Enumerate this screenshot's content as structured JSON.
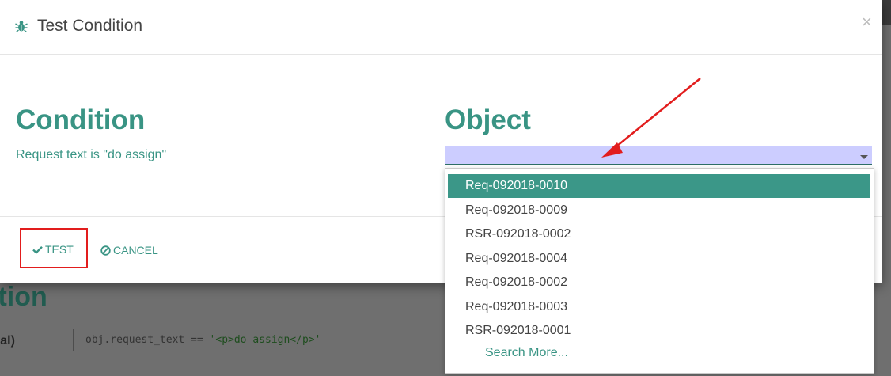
{
  "background": {
    "heading": "ition",
    "field_label": "ral)",
    "code": {
      "prefix": "obj.request_text == ",
      "value": "'<p>do assign</p>'"
    }
  },
  "modal": {
    "icon": "bug-icon",
    "title": "Test Condition",
    "close_label": "×"
  },
  "condition": {
    "heading": "Condition",
    "text": "Request text is \"do assign\""
  },
  "object": {
    "heading": "Object",
    "value": "",
    "options": [
      "Req-092018-0010",
      "Req-092018-0009",
      "RSR-092018-0002",
      "Req-092018-0004",
      "Req-092018-0002",
      "Req-092018-0003",
      "RSR-092018-0001"
    ],
    "highlighted_option": 0,
    "search_more": "Search More..."
  },
  "footer": {
    "test_label": "TEST",
    "cancel_label": "CANCEL"
  },
  "colors": {
    "accent": "#399484",
    "highlight": "#3b9788",
    "annotation": "#e21d1d",
    "select_bg": "#cccdff"
  }
}
